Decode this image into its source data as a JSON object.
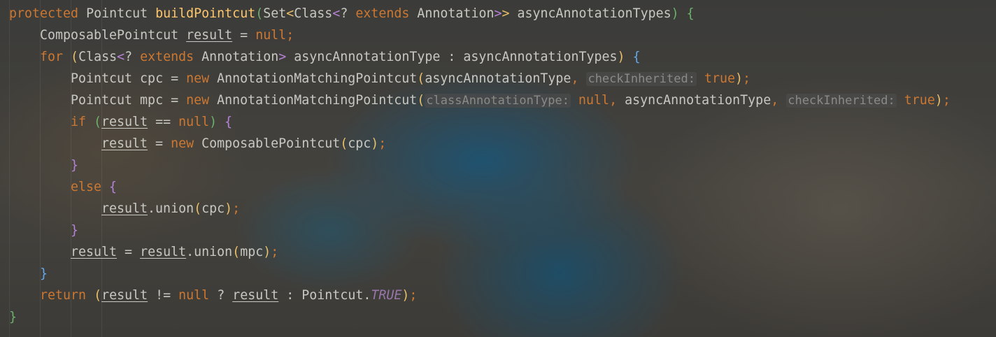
{
  "editor": {
    "lines": [
      {
        "indent": 0,
        "tokens": [
          {
            "t": "protected",
            "c": "kw"
          },
          {
            "t": " Pointcut ",
            "c": "pl"
          },
          {
            "t": "buildPointcut",
            "c": "fn"
          },
          {
            "t": "(",
            "c": "p4"
          },
          {
            "t": "Set",
            "c": "pl"
          },
          {
            "t": "<",
            "c": "p1"
          },
          {
            "t": "Class",
            "c": "pl"
          },
          {
            "t": "<",
            "c": "p2"
          },
          {
            "t": "? ",
            "c": "pl"
          },
          {
            "t": "extends",
            "c": "kw"
          },
          {
            "t": " Annotation",
            "c": "pl"
          },
          {
            "t": ">",
            "c": "p2"
          },
          {
            "t": ">",
            "c": "p1"
          },
          {
            "t": " asyncAnnotationTypes",
            "c": "pl"
          },
          {
            "t": ") ",
            "c": "p4"
          },
          {
            "t": "{",
            "c": "p4"
          }
        ]
      },
      {
        "indent": 1,
        "tokens": [
          {
            "t": "ComposablePointcut ",
            "c": "pl"
          },
          {
            "t": "result",
            "c": "pl ul"
          },
          {
            "t": " = ",
            "c": "pl"
          },
          {
            "t": "null",
            "c": "kw"
          },
          {
            "t": ";",
            "c": "kw"
          }
        ]
      },
      {
        "indent": 1,
        "tokens": [
          {
            "t": "for",
            "c": "kw"
          },
          {
            "t": " ",
            "c": "pl"
          },
          {
            "t": "(",
            "c": "p1"
          },
          {
            "t": "Class",
            "c": "pl"
          },
          {
            "t": "<",
            "c": "p2"
          },
          {
            "t": "? ",
            "c": "pl"
          },
          {
            "t": "extends",
            "c": "kw"
          },
          {
            "t": " Annotation",
            "c": "pl"
          },
          {
            "t": ">",
            "c": "p2"
          },
          {
            "t": " asyncAnnotationType : asyncAnnotationTypes",
            "c": "pl"
          },
          {
            "t": ") ",
            "c": "p1"
          },
          {
            "t": "{",
            "c": "p3"
          }
        ]
      },
      {
        "indent": 2,
        "tokens": [
          {
            "t": "Pointcut cpc = ",
            "c": "pl"
          },
          {
            "t": "new",
            "c": "kw"
          },
          {
            "t": " AnnotationMatchingPointcut",
            "c": "pl"
          },
          {
            "t": "(",
            "c": "p1"
          },
          {
            "t": "asyncAnnotationType",
            "c": "pl"
          },
          {
            "t": ", ",
            "c": "kw"
          },
          {
            "t": "checkInherited:",
            "c": "hint"
          },
          {
            "t": " ",
            "c": "pl"
          },
          {
            "t": "true",
            "c": "kw"
          },
          {
            "t": ")",
            "c": "p1"
          },
          {
            "t": ";",
            "c": "kw"
          }
        ]
      },
      {
        "indent": 2,
        "tokens": [
          {
            "t": "Pointcut mpc = ",
            "c": "pl"
          },
          {
            "t": "new",
            "c": "kw"
          },
          {
            "t": " AnnotationMatchingPointcut",
            "c": "pl"
          },
          {
            "t": "(",
            "c": "p1"
          },
          {
            "t": "classAnnotationType:",
            "c": "hint"
          },
          {
            "t": " ",
            "c": "pl"
          },
          {
            "t": "null",
            "c": "kw"
          },
          {
            "t": ", ",
            "c": "kw"
          },
          {
            "t": "asyncAnnotationType",
            "c": "pl"
          },
          {
            "t": ", ",
            "c": "kw"
          },
          {
            "t": "checkInherited:",
            "c": "hint"
          },
          {
            "t": " ",
            "c": "pl"
          },
          {
            "t": "true",
            "c": "kw"
          },
          {
            "t": ")",
            "c": "p1"
          },
          {
            "t": ";",
            "c": "kw"
          }
        ]
      },
      {
        "indent": 2,
        "tokens": [
          {
            "t": "if",
            "c": "kw"
          },
          {
            "t": " ",
            "c": "pl"
          },
          {
            "t": "(",
            "c": "p4"
          },
          {
            "t": "result",
            "c": "pl ul"
          },
          {
            "t": " == ",
            "c": "pl"
          },
          {
            "t": "null",
            "c": "kw"
          },
          {
            "t": ") ",
            "c": "p4"
          },
          {
            "t": "{",
            "c": "p2"
          }
        ]
      },
      {
        "indent": 3,
        "tokens": [
          {
            "t": "result",
            "c": "pl ul"
          },
          {
            "t": " = ",
            "c": "pl"
          },
          {
            "t": "new",
            "c": "kw"
          },
          {
            "t": " ComposablePointcut",
            "c": "pl"
          },
          {
            "t": "(",
            "c": "p1"
          },
          {
            "t": "cpc",
            "c": "pl"
          },
          {
            "t": ")",
            "c": "p1"
          },
          {
            "t": ";",
            "c": "kw"
          }
        ]
      },
      {
        "indent": 2,
        "tokens": [
          {
            "t": "}",
            "c": "p2"
          }
        ]
      },
      {
        "indent": 2,
        "tokens": [
          {
            "t": "else",
            "c": "kw"
          },
          {
            "t": " ",
            "c": "pl"
          },
          {
            "t": "{",
            "c": "p2"
          }
        ]
      },
      {
        "indent": 3,
        "tokens": [
          {
            "t": "result",
            "c": "pl ul"
          },
          {
            "t": ".union",
            "c": "pl"
          },
          {
            "t": "(",
            "c": "p1"
          },
          {
            "t": "cpc",
            "c": "pl"
          },
          {
            "t": ")",
            "c": "p1"
          },
          {
            "t": ";",
            "c": "kw"
          }
        ]
      },
      {
        "indent": 2,
        "tokens": [
          {
            "t": "}",
            "c": "p2"
          }
        ]
      },
      {
        "indent": 2,
        "tokens": [
          {
            "t": "result",
            "c": "pl ul"
          },
          {
            "t": " = ",
            "c": "pl"
          },
          {
            "t": "result",
            "c": "pl ul"
          },
          {
            "t": ".union",
            "c": "pl"
          },
          {
            "t": "(",
            "c": "p1"
          },
          {
            "t": "mpc",
            "c": "pl"
          },
          {
            "t": ")",
            "c": "p1"
          },
          {
            "t": ";",
            "c": "kw"
          }
        ]
      },
      {
        "indent": 1,
        "tokens": [
          {
            "t": "}",
            "c": "p3"
          }
        ]
      },
      {
        "indent": 1,
        "tokens": [
          {
            "t": "return",
            "c": "kw"
          },
          {
            "t": " ",
            "c": "pl"
          },
          {
            "t": "(",
            "c": "p1"
          },
          {
            "t": "result",
            "c": "pl ul"
          },
          {
            "t": " != ",
            "c": "pl"
          },
          {
            "t": "null",
            "c": "kw"
          },
          {
            "t": " ? ",
            "c": "pl"
          },
          {
            "t": "result",
            "c": "pl ul"
          },
          {
            "t": " : Pointcut.",
            "c": "pl"
          },
          {
            "t": "TRUE",
            "c": "it"
          },
          {
            "t": ")",
            "c": "p1"
          },
          {
            "t": ";",
            "c": "kw"
          }
        ]
      },
      {
        "indent": 0,
        "tokens": [
          {
            "t": "}",
            "c": "p4"
          }
        ]
      }
    ]
  },
  "colors": {
    "keyword": "#cc7832",
    "method_declaration": "#ffc66d",
    "plain": "#c8c8c2",
    "constant": "#9876aa",
    "inlay_hint": "#8a8a86",
    "paren_level_1": "#e8bf6a",
    "paren_level_2": "#b482d6",
    "paren_level_3": "#62a8ea",
    "paren_level_4": "#6cb06c"
  }
}
